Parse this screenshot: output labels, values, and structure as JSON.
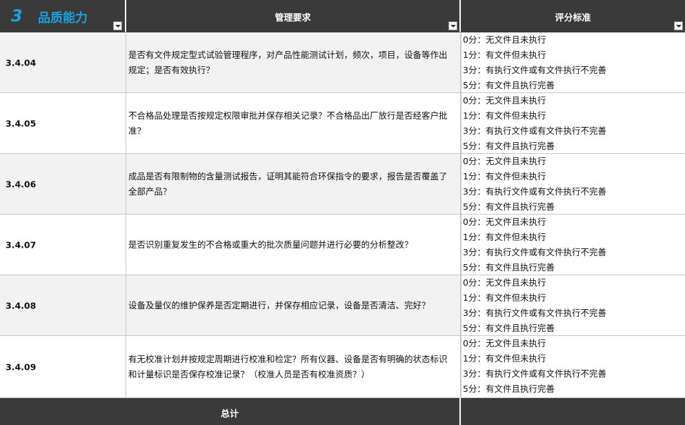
{
  "header": {
    "section_number": "3",
    "section_title": "品质能力",
    "col_requirement": "管理要求",
    "col_criteria": "评分标准"
  },
  "score_labels": [
    "0分：无文件且未执行",
    "1分：有文件但未执行",
    "3分：有执行文件或有文件执行不完善",
    "5分：有文件且执行完善"
  ],
  "rows": [
    {
      "code": "3.4.04",
      "requirement": "是否有文件规定型式试验管理程序，对产品性能测试计划，频次，项目，设备等作出规定；是否有效执行？"
    },
    {
      "code": "3.4.05",
      "requirement": "不合格品处理是否按规定权限审批并保存相关记录？不合格品出厂放行是否经客户批准？"
    },
    {
      "code": "3.4.06",
      "requirement": "成品是否有限制物的含量测试报告，证明其能符合环保指令的要求，报告是否覆盖了全部产品？"
    },
    {
      "code": "3.4.07",
      "requirement": "是否识别重复发生的不合格或重大的批次质量问题并进行必要的分析整改？"
    },
    {
      "code": "3.4.08",
      "requirement": "设备及量仪的维护保养是否定期进行，并保存相应记录，设备是否清洁、完好？"
    },
    {
      "code": "3.4.09",
      "requirement": "有无校准计划并按规定周期进行校准和检定？所有仪器、设备是否有明确的状态标识和计量标识是否保存校准记录？（校准人员是否有校准资质？）"
    }
  ],
  "footer": {
    "total_label": "总计"
  }
}
